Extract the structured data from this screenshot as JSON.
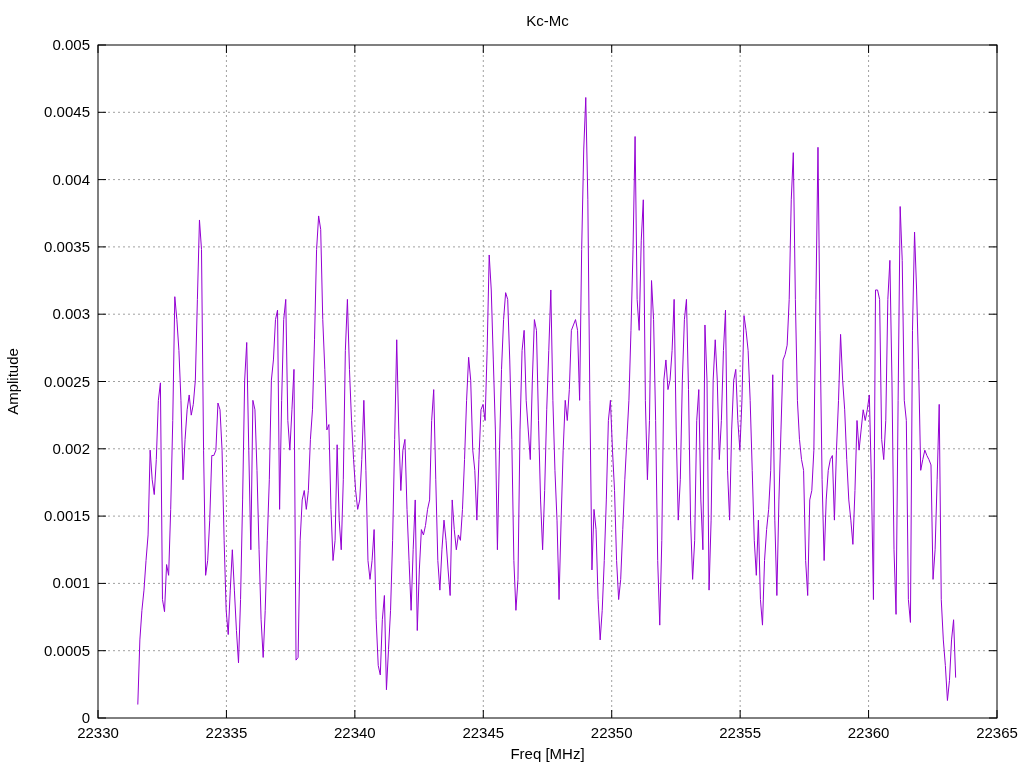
{
  "chart": {
    "chart_data": {
      "type": "line",
      "grid": true,
      "title": "Kc-Mc",
      "xlabel": "Freq [MHz]",
      "ylabel": "Amplitude",
      "xlim": [
        22330,
        22365
      ],
      "ylim": [
        0,
        0.005
      ],
      "xticks": [
        22330,
        22335,
        22340,
        22345,
        22350,
        22355,
        22360,
        22365
      ],
      "yticks": [
        0,
        0.0005,
        0.001,
        0.0015,
        0.002,
        0.0025,
        0.003,
        0.0035,
        0.004,
        0.0045,
        0.005
      ],
      "x": [
        22331.55,
        22331.63,
        22331.71,
        22331.79,
        22331.87,
        22331.95,
        22332.03,
        22332.11,
        22332.19,
        22332.27,
        22332.35,
        22332.43,
        22332.51,
        22332.59,
        22332.67,
        22332.75,
        22332.83,
        22332.91,
        22332.99,
        22333.07,
        22333.15,
        22333.23,
        22333.31,
        22333.39,
        22333.47,
        22333.55,
        22333.63,
        22333.71,
        22333.79,
        22333.87,
        22333.95,
        22334.03,
        22334.11,
        22334.19,
        22334.27,
        22334.35,
        22334.43,
        22334.51,
        22334.59,
        22334.67,
        22334.75,
        22334.83,
        22334.91,
        22334.99,
        22335.07,
        22335.15,
        22335.23,
        22335.31,
        22335.39,
        22335.47,
        22335.55,
        22335.63,
        22335.71,
        22335.79,
        22335.87,
        22335.95,
        22336.03,
        22336.11,
        22336.19,
        22336.27,
        22336.35,
        22336.43,
        22336.51,
        22336.59,
        22336.67,
        22336.75,
        22336.83,
        22336.91,
        22336.99,
        22337.07,
        22337.15,
        22337.23,
        22337.31,
        22337.39,
        22337.47,
        22337.55,
        22337.63,
        22337.71,
        22337.79,
        22337.87,
        22337.95,
        22338.03,
        22338.11,
        22338.19,
        22338.27,
        22338.35,
        22338.43,
        22338.51,
        22338.59,
        22338.67,
        22338.75,
        22338.83,
        22338.91,
        22338.99,
        22339.07,
        22339.15,
        22339.23,
        22339.31,
        22339.39,
        22339.47,
        22339.55,
        22339.63,
        22339.71,
        22339.79,
        22339.87,
        22339.95,
        22340.03,
        22340.11,
        22340.19,
        22340.27,
        22340.35,
        22340.43,
        22340.51,
        22340.59,
        22340.67,
        22340.75,
        22340.83,
        22340.91,
        22340.99,
        22341.07,
        22341.15,
        22341.23,
        22341.31,
        22341.39,
        22341.47,
        22341.55,
        22341.63,
        22341.71,
        22341.79,
        22341.87,
        22341.95,
        22342.03,
        22342.11,
        22342.19,
        22342.27,
        22342.35,
        22342.43,
        22342.51,
        22342.59,
        22342.67,
        22342.75,
        22342.83,
        22342.91,
        22342.99,
        22343.07,
        22343.15,
        22343.23,
        22343.31,
        22343.39,
        22343.47,
        22343.55,
        22343.63,
        22343.71,
        22343.79,
        22343.87,
        22343.95,
        22344.03,
        22344.11,
        22344.19,
        22344.27,
        22344.35,
        22344.43,
        22344.51,
        22344.59,
        22344.67,
        22344.75,
        22344.83,
        22344.91,
        22344.99,
        22345.07,
        22345.15,
        22345.23,
        22345.31,
        22345.39,
        22345.47,
        22345.55,
        22345.63,
        22345.71,
        22345.79,
        22345.87,
        22345.95,
        22346.03,
        22346.11,
        22346.19,
        22346.27,
        22346.35,
        22346.43,
        22346.51,
        22346.59,
        22346.67,
        22346.75,
        22346.83,
        22346.91,
        22346.99,
        22347.07,
        22347.15,
        22347.23,
        22347.31,
        22347.39,
        22347.47,
        22347.55,
        22347.63,
        22347.71,
        22347.79,
        22347.87,
        22347.95,
        22348.03,
        22348.11,
        22348.19,
        22348.27,
        22348.35,
        22348.43,
        22348.51,
        22348.59,
        22348.67,
        22348.75,
        22348.83,
        22348.91,
        22348.99,
        22349.07,
        22349.15,
        22349.23,
        22349.31,
        22349.39,
        22349.47,
        22349.55,
        22349.63,
        22349.71,
        22349.79,
        22349.87,
        22349.95,
        22350.03,
        22350.11,
        22350.19,
        22350.27,
        22350.35,
        22350.43,
        22350.51,
        22350.59,
        22350.67,
        22350.75,
        22350.83,
        22350.91,
        22350.99,
        22351.07,
        22351.15,
        22351.23,
        22351.31,
        22351.39,
        22351.47,
        22351.55,
        22351.63,
        22351.71,
        22351.79,
        22351.87,
        22351.95,
        22352.03,
        22352.11,
        22352.19,
        22352.27,
        22352.35,
        22352.43,
        22352.51,
        22352.59,
        22352.67,
        22352.75,
        22352.83,
        22352.91,
        22352.99,
        22353.07,
        22353.15,
        22353.23,
        22353.31,
        22353.39,
        22353.47,
        22353.55,
        22353.63,
        22353.71,
        22353.79,
        22353.87,
        22353.95,
        22354.03,
        22354.11,
        22354.19,
        22354.27,
        22354.35,
        22354.43,
        22354.51,
        22354.59,
        22354.67,
        22354.75,
        22354.83,
        22354.91,
        22354.99,
        22355.07,
        22355.15,
        22355.23,
        22355.31,
        22355.39,
        22355.47,
        22355.55,
        22355.63,
        22355.71,
        22355.79,
        22355.87,
        22355.95,
        22356.03,
        22356.11,
        22356.19,
        22356.27,
        22356.35,
        22356.43,
        22356.51,
        22356.59,
        22356.67,
        22356.75,
        22356.83,
        22356.91,
        22356.99,
        22357.07,
        22357.15,
        22357.23,
        22357.31,
        22357.39,
        22357.47,
        22357.55,
        22357.63,
        22357.71,
        22357.79,
        22357.87,
        22357.95,
        22358.03,
        22358.11,
        22358.19,
        22358.27,
        22358.35,
        22358.43,
        22358.51,
        22358.59,
        22358.67,
        22358.75,
        22358.83,
        22358.91,
        22358.99,
        22359.07,
        22359.15,
        22359.23,
        22359.31,
        22359.39,
        22359.47,
        22359.55,
        22359.63,
        22359.71,
        22359.79,
        22359.87,
        22359.95,
        22360.03,
        22360.11,
        22360.19,
        22360.27,
        22360.35,
        22360.43,
        22360.51,
        22360.59,
        22360.67,
        22360.75,
        22360.83,
        22360.91,
        22360.99,
        22361.07,
        22361.15,
        22361.23,
        22361.31,
        22361.39,
        22361.47,
        22361.55,
        22361.63,
        22361.71,
        22361.79,
        22361.87,
        22361.95,
        22362.03,
        22362.11,
        22362.19,
        22362.27,
        22362.35,
        22362.43,
        22362.51,
        22362.59,
        22362.67,
        22362.75,
        22362.83,
        22362.91,
        22362.99,
        22363.07,
        22363.15,
        22363.23,
        22363.31,
        22363.39
      ],
      "series": [
        {
          "color": "#9400d3",
          "values": [
            0.0001,
            0.00058,
            0.0008,
            0.00095,
            0.00117,
            0.00136,
            0.00199,
            0.00177,
            0.00166,
            0.00192,
            0.00236,
            0.00249,
            0.00088,
            0.00079,
            0.00114,
            0.00106,
            0.00155,
            0.00221,
            0.00313,
            0.00296,
            0.00273,
            0.00236,
            0.00177,
            0.00207,
            0.00229,
            0.0024,
            0.00225,
            0.00233,
            0.00251,
            0.00311,
            0.0037,
            0.00348,
            0.00199,
            0.00106,
            0.00117,
            0.00147,
            0.00195,
            0.00195,
            0.00199,
            0.00234,
            0.00229,
            0.00199,
            0.00132,
            0.0008,
            0.00062,
            0.00095,
            0.00125,
            0.00095,
            0.00065,
            0.00041,
            0.00088,
            0.00162,
            0.00251,
            0.00279,
            0.00199,
            0.00125,
            0.00236,
            0.00229,
            0.00184,
            0.00125,
            0.00073,
            0.00045,
            0.0008,
            0.00132,
            0.00177,
            0.00251,
            0.00266,
            0.00296,
            0.00303,
            0.00155,
            0.00236,
            0.00296,
            0.00311,
            0.00221,
            0.00199,
            0.00229,
            0.00259,
            0.00043,
            0.00045,
            0.00132,
            0.00162,
            0.00169,
            0.00155,
            0.00169,
            0.00207,
            0.00229,
            0.00281,
            0.00348,
            0.00373,
            0.00363,
            0.00296,
            0.00259,
            0.00214,
            0.00218,
            0.00155,
            0.00117,
            0.00132,
            0.00203,
            0.00147,
            0.00125,
            0.00177,
            0.00273,
            0.00311,
            0.00259,
            0.00221,
            0.00192,
            0.00169,
            0.00155,
            0.00162,
            0.00192,
            0.00236,
            0.00184,
            0.00117,
            0.00103,
            0.00117,
            0.0014,
            0.00073,
            0.00039,
            0.00032,
            0.00073,
            0.00091,
            0.00021,
            0.00051,
            0.0008,
            0.00132,
            0.00207,
            0.00281,
            0.00214,
            0.00169,
            0.00199,
            0.00207,
            0.00155,
            0.00117,
            0.0008,
            0.00125,
            0.00162,
            0.00065,
            0.0011,
            0.0014,
            0.00136,
            0.00143,
            0.00155,
            0.00162,
            0.00221,
            0.00244,
            0.00177,
            0.00117,
            0.00095,
            0.00125,
            0.00147,
            0.00132,
            0.0011,
            0.00091,
            0.00162,
            0.0014,
            0.00125,
            0.00136,
            0.00132,
            0.00155,
            0.00192,
            0.00236,
            0.00268,
            0.00251,
            0.00199,
            0.00184,
            0.00147,
            0.00192,
            0.00229,
            0.00233,
            0.00221,
            0.00273,
            0.00344,
            0.00318,
            0.00266,
            0.00214,
            0.00125,
            0.00199,
            0.00259,
            0.00296,
            0.00316,
            0.00311,
            0.00266,
            0.00207,
            0.00117,
            0.0008,
            0.00103,
            0.00214,
            0.00273,
            0.00288,
            0.00236,
            0.00214,
            0.00192,
            0.00251,
            0.00296,
            0.00288,
            0.00221,
            0.00162,
            0.00125,
            0.00169,
            0.00229,
            0.00273,
            0.00318,
            0.00236,
            0.00184,
            0.00147,
            0.00088,
            0.00147,
            0.00199,
            0.00236,
            0.00221,
            0.00244,
            0.00288,
            0.00292,
            0.00296,
            0.00288,
            0.00236,
            0.00348,
            0.00422,
            0.00461,
            0.00385,
            0.00236,
            0.0011,
            0.00155,
            0.0014,
            0.00088,
            0.00058,
            0.0008,
            0.00117,
            0.00162,
            0.00221,
            0.00236,
            0.00199,
            0.00169,
            0.00117,
            0.00088,
            0.00103,
            0.0014,
            0.00177,
            0.00207,
            0.00236,
            0.00288,
            0.00348,
            0.00432,
            0.00311,
            0.00288,
            0.00355,
            0.00385,
            0.00236,
            0.00177,
            0.00221,
            0.00325,
            0.00296,
            0.00221,
            0.00117,
            0.00069,
            0.00132,
            0.00251,
            0.00266,
            0.00244,
            0.00251,
            0.00273,
            0.00311,
            0.00214,
            0.00147,
            0.00177,
            0.00251,
            0.00296,
            0.00311,
            0.00244,
            0.00147,
            0.00103,
            0.00132,
            0.00221,
            0.00244,
            0.00162,
            0.00125,
            0.00292,
            0.00251,
            0.00095,
            0.00147,
            0.00251,
            0.00281,
            0.00251,
            0.00192,
            0.00221,
            0.00273,
            0.00303,
            0.00184,
            0.00147,
            0.00214,
            0.00251,
            0.00259,
            0.00221,
            0.00199,
            0.00236,
            0.00299,
            0.00288,
            0.00273,
            0.00236,
            0.00184,
            0.00132,
            0.00106,
            0.00147,
            0.00088,
            0.00069,
            0.00117,
            0.0014,
            0.00155,
            0.00184,
            0.00255,
            0.00147,
            0.00091,
            0.00162,
            0.00214,
            0.00266,
            0.0027,
            0.00277,
            0.00311,
            0.00385,
            0.0042,
            0.00311,
            0.00236,
            0.00207,
            0.00192,
            0.00184,
            0.00117,
            0.00091,
            0.00162,
            0.00169,
            0.00199,
            0.00311,
            0.00424,
            0.00288,
            0.00177,
            0.00117,
            0.00162,
            0.00184,
            0.00192,
            0.00195,
            0.00147,
            0.00199,
            0.00236,
            0.00285,
            0.00251,
            0.00229,
            0.00192,
            0.00162,
            0.00147,
            0.00129,
            0.00169,
            0.00221,
            0.00199,
            0.00214,
            0.00229,
            0.00221,
            0.00229,
            0.0024,
            0.00177,
            0.00088,
            0.00318,
            0.00318,
            0.00311,
            0.00207,
            0.00192,
            0.00221,
            0.00311,
            0.0034,
            0.00251,
            0.00125,
            0.00077,
            0.00236,
            0.0038,
            0.0034,
            0.00236,
            0.00221,
            0.00088,
            0.00071,
            0.00288,
            0.00361,
            0.00318,
            0.00259,
            0.00184,
            0.00192,
            0.00199,
            0.00195,
            0.00192,
            0.00188,
            0.00103,
            0.00125,
            0.00177,
            0.00233,
            0.00088,
            0.00058,
            0.00039,
            0.00013,
            0.00028,
            0.00058,
            0.00073,
            0.0003
          ]
        }
      ]
    }
  }
}
